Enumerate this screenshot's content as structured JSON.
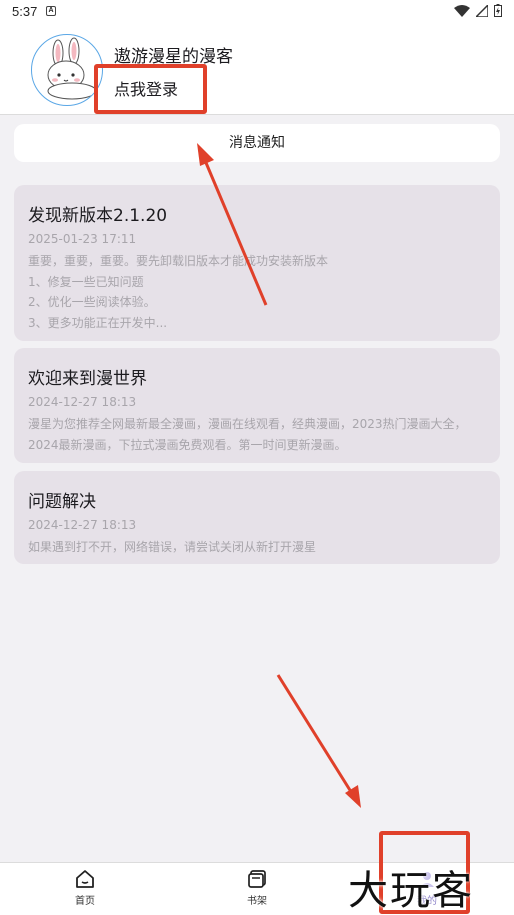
{
  "status_bar": {
    "time": "5:37",
    "notif_letter": "A"
  },
  "profile": {
    "username": "遨游漫星的漫客",
    "login_label": "点我登录"
  },
  "notify_button": "消息通知",
  "cards": [
    {
      "title": "发现新版本2.1.20",
      "date": "2025-01-23 17:11",
      "lines": [
        "重要，重要，重要。要先卸载旧版本才能成功安装新版本",
        "1、修复一些已知问题",
        "2、优化一些阅读体验。",
        "3、更多功能正在开发中..."
      ]
    },
    {
      "title": "欢迎来到漫世界",
      "date": "2024-12-27 18:13",
      "lines": [
        "漫星为您推荐全网最新最全漫画，漫画在线观看，经典漫画，2023热门漫画大全，",
        "2024最新漫画，下拉式漫画免费观看。第一时间更新漫画。"
      ]
    },
    {
      "title": "问题解决",
      "date": "2024-12-27 18:13",
      "lines": [
        "如果遇到打不开，网络错误，请尝试关闭从新打开漫星"
      ]
    }
  ],
  "nav": [
    {
      "label": "首页",
      "icon": "home-icon"
    },
    {
      "label": "书架",
      "icon": "bookshelf-icon"
    },
    {
      "label": "我的",
      "icon": "profile-icon"
    }
  ],
  "watermark": "大玩客",
  "colors": {
    "annotation_red": "#e0402a",
    "active_tab": "#8a7fc8"
  }
}
